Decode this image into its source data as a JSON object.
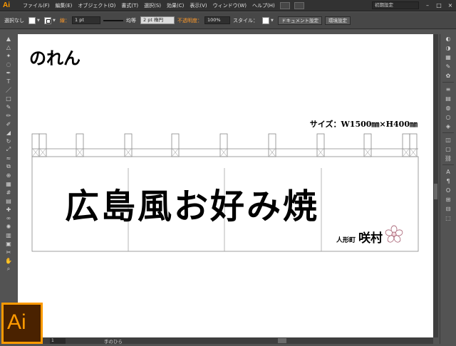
{
  "menubar": {
    "app_logo": "Ai",
    "items": [
      "ファイル(F)",
      "編集(E)",
      "オブジェクト(O)",
      "書式(T)",
      "選択(S)",
      "効果(C)",
      "表示(V)",
      "ウィンドウ(W)",
      "ヘルプ(H)"
    ],
    "workspace": "初期設定",
    "window_buttons": [
      "–",
      "□",
      "×"
    ]
  },
  "controlbar": {
    "selection_label": "選択なし",
    "stroke_label": "線：",
    "stroke_weight": "1 pt",
    "profile_label": "均等",
    "brush_label": "2 pt 楕円",
    "opacity_label": "不透明度：",
    "opacity_value": "100%",
    "style_label": "スタイル：",
    "document_setup_button": "ドキュメント設定",
    "preferences_button": "環境設定"
  },
  "artboard": {
    "title": "のれん",
    "size_label": "サイズ：W1500㎜×H400㎜",
    "main_text": "広島風お好み焼",
    "shop_sub": "人形町",
    "shop_name": "咲村"
  },
  "status": {
    "zoom": "",
    "page": "1",
    "tool_name": "手のひら"
  },
  "app_badge": "Ai",
  "colors": {
    "accent": "#ff9a00",
    "menubar_bg": "#323232",
    "panel_bg": "#535353",
    "canvas_bg": "#ffffff"
  },
  "tools": [
    "selection-tool-icon",
    "direct-selection-tool-icon",
    "magic-wand-icon",
    "lasso-icon",
    "pen-tool-icon",
    "type-tool-icon",
    "line-tool-icon",
    "rectangle-tool-icon",
    "paintbrush-icon",
    "pencil-icon",
    "blob-brush-icon",
    "eraser-icon",
    "rotate-icon",
    "scale-icon",
    "width-tool-icon",
    "free-transform-icon",
    "shape-builder-icon",
    "perspective-grid-icon",
    "mesh-icon",
    "gradient-icon",
    "eyedropper-icon",
    "blend-icon",
    "symbol-sprayer-icon",
    "column-graph-icon",
    "artboard-tool-icon",
    "slice-icon",
    "hand-tool-icon",
    "zoom-tool-icon"
  ],
  "dock_icons": [
    "color-panel-icon",
    "color-guide-icon",
    "swatches-icon",
    "brushes-icon",
    "symbols-icon",
    "stroke-panel-icon",
    "gradient-panel-icon",
    "transparency-icon",
    "appearance-icon",
    "graphic-styles-icon",
    "layers-icon",
    "artboards-icon",
    "links-icon",
    "type-panel-icon",
    "paragraph-icon",
    "opentype-icon",
    "align-icon",
    "pathfinder-icon",
    "transform-icon"
  ]
}
